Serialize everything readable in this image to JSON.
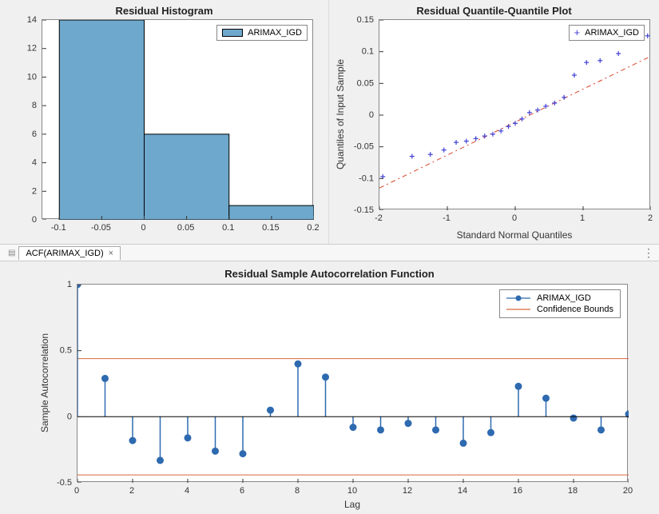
{
  "topLeft": {
    "title": "Residual Histogram",
    "legend": "ARIMAX_IGD",
    "xticks": [
      -0.1,
      -0.05,
      0,
      0.05,
      0.1,
      0.15,
      0.2
    ],
    "yticks": [
      0,
      2,
      4,
      6,
      8,
      10,
      12,
      14
    ]
  },
  "topRight": {
    "title": "Residual Quantile-Quantile Plot",
    "legend": "ARIMAX_IGD",
    "xlabel": "Standard Normal Quantiles",
    "ylabel": "Quantiles of Input Sample",
    "xticks": [
      -2,
      -1,
      0,
      1,
      2
    ],
    "yticks": [
      -0.15,
      -0.1,
      -0.05,
      0,
      0.05,
      0.1,
      0.15
    ]
  },
  "tab": {
    "label": "ACF(ARIMAX_IGD)"
  },
  "bottom": {
    "title": "Residual Sample Autocorrelation Function",
    "legend1": "ARIMAX_IGD",
    "legend2": "Confidence Bounds",
    "xlabel": "Lag",
    "ylabel": "Sample Autocorrelation",
    "xticks": [
      0,
      2,
      4,
      6,
      8,
      10,
      12,
      14,
      16,
      18,
      20
    ],
    "yticks": [
      -0.5,
      0,
      0.5,
      1
    ]
  },
  "chart_data": [
    {
      "type": "bar",
      "title": "Residual Histogram",
      "series_name": "ARIMAX_IGD",
      "bin_edges": [
        -0.1,
        0,
        0.1,
        0.2
      ],
      "values": [
        14,
        6,
        1
      ],
      "xlim": [
        -0.12,
        0.2
      ],
      "ylim": [
        0,
        14
      ]
    },
    {
      "type": "scatter",
      "title": "Residual Quantile-Quantile Plot",
      "series_name": "ARIMAX_IGD",
      "x": [
        -1.95,
        -1.52,
        -1.25,
        -1.05,
        -0.87,
        -0.72,
        -0.58,
        -0.45,
        -0.33,
        -0.21,
        -0.1,
        0,
        0.1,
        0.21,
        0.33,
        0.45,
        0.58,
        0.72,
        0.87,
        1.05,
        1.25,
        1.52,
        1.95
      ],
      "y": [
        -0.097,
        -0.065,
        -0.062,
        -0.055,
        -0.043,
        -0.041,
        -0.037,
        -0.033,
        -0.03,
        -0.025,
        -0.018,
        -0.013,
        -0.006,
        0.004,
        0.008,
        0.014,
        0.019,
        0.028,
        0.063,
        0.083,
        0.086,
        0.097,
        0.125
      ],
      "reference_line": {
        "x": [
          -2,
          2
        ],
        "y": [
          -0.115,
          0.093
        ]
      },
      "xlabel": "Standard Normal Quantiles",
      "ylabel": "Quantiles of Input Sample",
      "xlim": [
        -2,
        2
      ],
      "ylim": [
        -0.15,
        0.15
      ]
    },
    {
      "type": "line",
      "subtype": "stem",
      "title": "Residual Sample Autocorrelation Function",
      "series_name": "ARIMAX_IGD",
      "x": [
        0,
        1,
        2,
        3,
        4,
        5,
        6,
        7,
        8,
        9,
        10,
        11,
        12,
        13,
        14,
        15,
        16,
        17,
        18,
        19,
        20
      ],
      "y": [
        1.0,
        0.29,
        -0.18,
        -0.33,
        -0.16,
        -0.26,
        -0.28,
        0.05,
        0.4,
        0.3,
        -0.08,
        -0.1,
        -0.05,
        -0.1,
        -0.2,
        -0.12,
        0.23,
        0.14,
        -0.01,
        -0.1,
        0.02
      ],
      "confidence_bounds": 0.44,
      "xlabel": "Lag",
      "ylabel": "Sample Autocorrelation",
      "xlim": [
        0,
        20
      ],
      "ylim": [
        -0.5,
        1
      ]
    }
  ]
}
